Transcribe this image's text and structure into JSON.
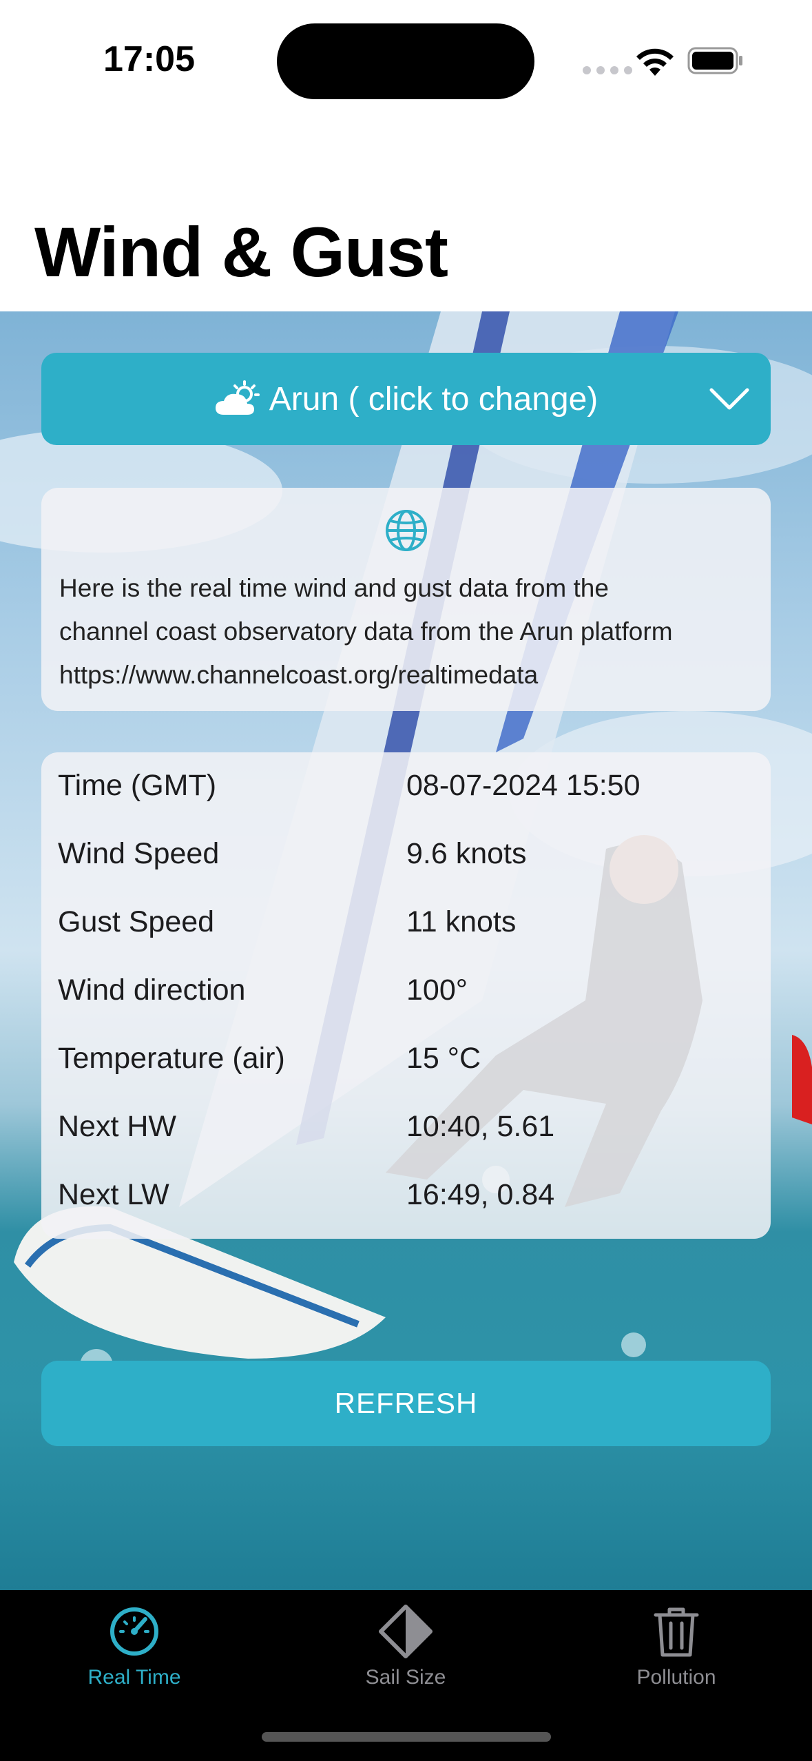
{
  "status_bar": {
    "time": "17:05"
  },
  "header": {
    "title": "Wind & Gust"
  },
  "location": {
    "label": "Arun ( click to change)",
    "icon": "cloud-sun-icon"
  },
  "info": {
    "icon": "globe-icon",
    "lines": [
      "Here is the real time wind and gust data from the",
      "channel coast observatory data from the Arun platform",
      "https://www.channelcoast.org/realtimedata"
    ]
  },
  "readings": [
    {
      "label": "Time (GMT)",
      "value": "08-07-2024 15:50"
    },
    {
      "label": "Wind Speed",
      "value": "9.6 knots"
    },
    {
      "label": "Gust Speed",
      "value": "11 knots"
    },
    {
      "label": "Wind direction",
      "value": "100°"
    },
    {
      "label": "Temperature (air)",
      "value": "15 °C"
    },
    {
      "label": "Next HW",
      "value": "10:40, 5.61"
    },
    {
      "label": "Next LW",
      "value": "16:49, 0.84"
    }
  ],
  "refresh": {
    "label": "REFRESH"
  },
  "tabs": [
    {
      "label": "Real Time",
      "icon": "gauge-icon",
      "active": true
    },
    {
      "label": "Sail Size",
      "icon": "sail-diamond-icon",
      "active": false
    },
    {
      "label": "Pollution",
      "icon": "trash-icon",
      "active": false
    }
  ],
  "colors": {
    "accent": "#2eafc8",
    "tab_bar": "#000000",
    "inactive_tab": "#8e8e93"
  }
}
